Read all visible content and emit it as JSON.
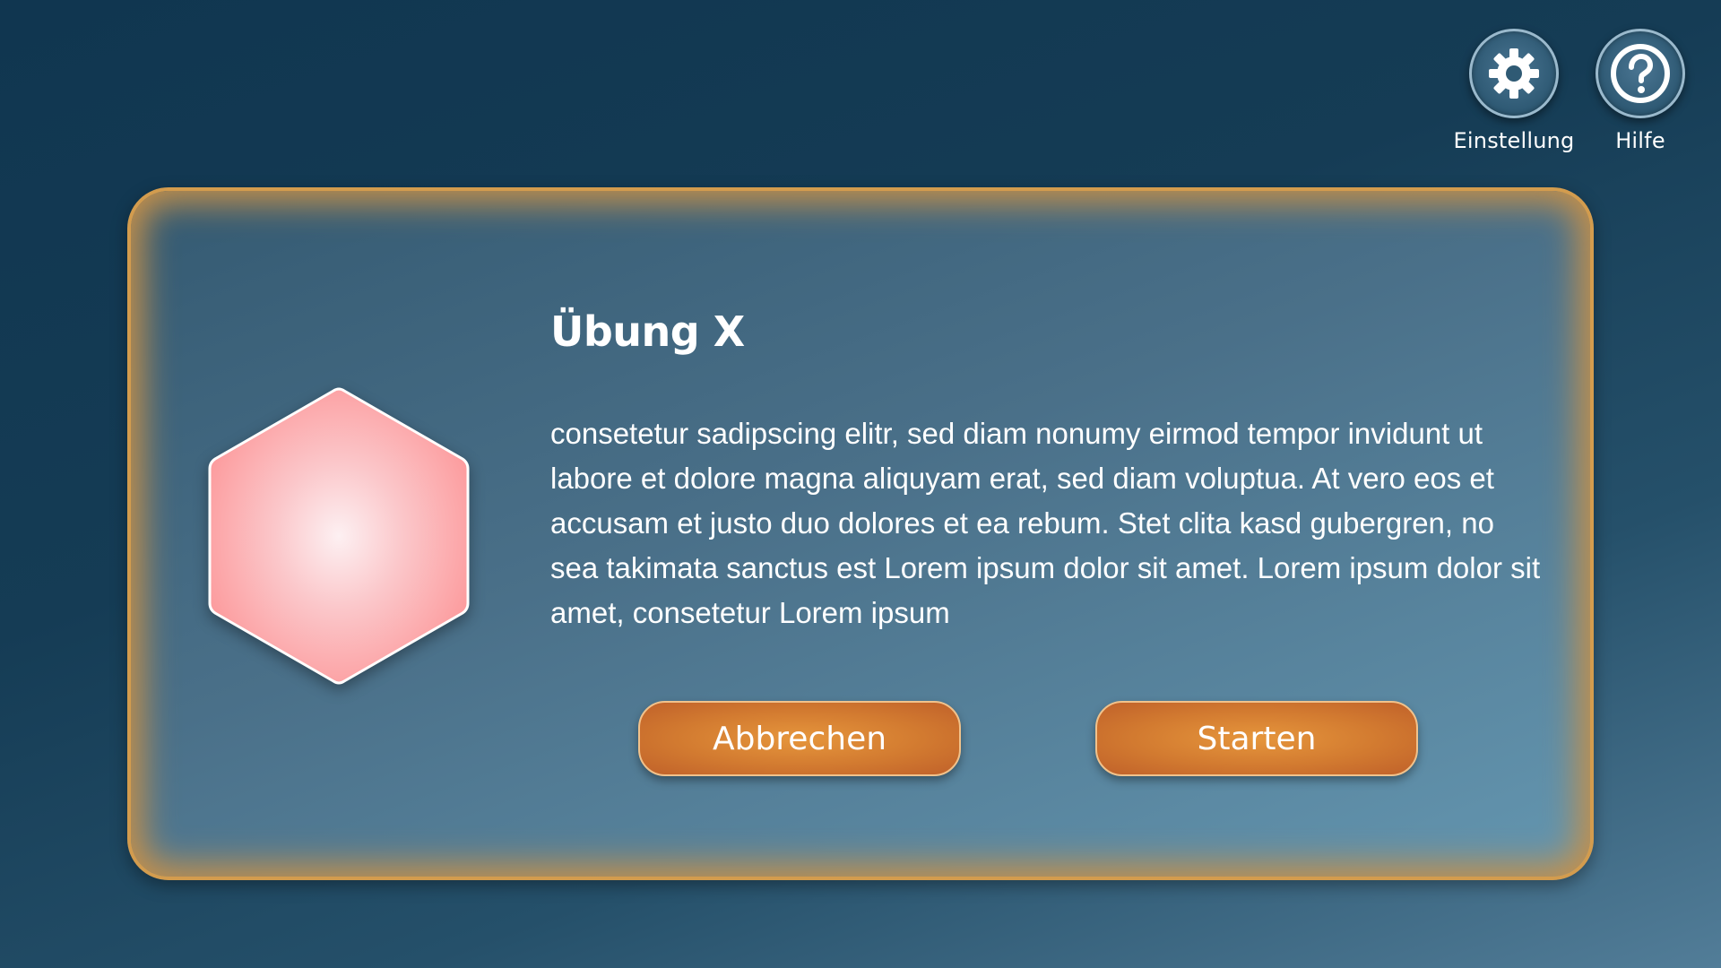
{
  "toolbar": {
    "settings_label": "Einstellung",
    "settings_icon": "gear-icon",
    "help_label": "Hilfe",
    "help_icon": "question-circle-icon"
  },
  "dialog": {
    "title": "Übung X",
    "description": "consetetur sadipscing elitr, sed diam nonumy eirmod tempor invidunt ut labore et dolore magna aliquyam erat, sed diam voluptua. At vero eos et accusam et justo duo dolores et ea rebum. Stet clita kasd gubergren, no sea takimata sanctus est Lorem ipsum dolor sit amet. Lorem ipsum dolor sit amet, consetetur Lorem ipsum",
    "icon": "hexagon-icon",
    "cancel_label": "Abbrechen",
    "start_label": "Starten"
  },
  "colors": {
    "background": "#153c55",
    "card_border": "#d39c4e",
    "button": "#d27a30",
    "hexagon": "#fc9c9e"
  }
}
